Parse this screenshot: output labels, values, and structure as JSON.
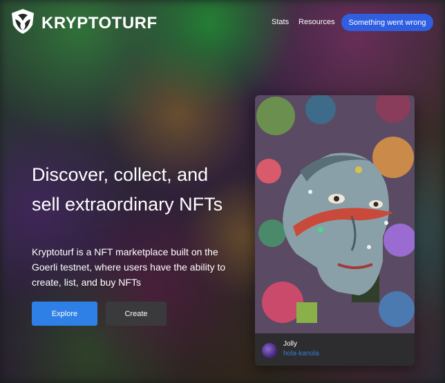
{
  "header": {
    "brand": "KRYPTOTURF",
    "nav": {
      "stats": "Stats",
      "resources": "Resources"
    },
    "connect_button": "Something went wrong"
  },
  "hero": {
    "title_line1": "Discover, collect, and",
    "title_line2": "sell extraordinary NFTs",
    "description": "Kryptoturf is a NFT marketplace built on the Goerli testnet, where users have the ability to create, list, and buy NFTs",
    "explore_label": "Explore",
    "create_label": "Create"
  },
  "featured_nft": {
    "name": "Jolly",
    "owner": "hola-kanola"
  },
  "colors": {
    "accent_button": "#2f5fe0",
    "explore_button": "#2f80e6",
    "create_button": "#3a3a3c",
    "owner_link": "#3a7bd5",
    "card_footer": "#2d2d2f"
  }
}
